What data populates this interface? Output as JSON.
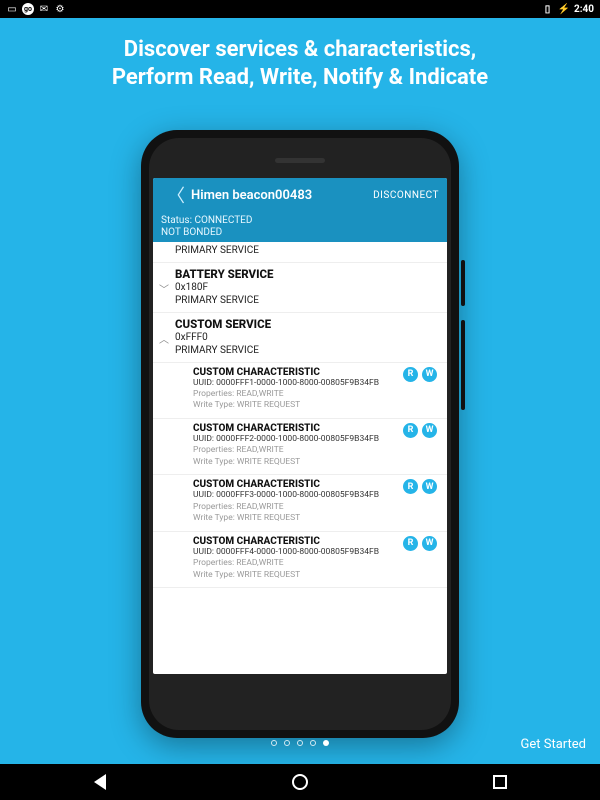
{
  "status_bar": {
    "time": "2:40",
    "battery_icon": "⚡"
  },
  "headline_1": "Discover services & characteristics,",
  "headline_2": "Perform Read, Write, Notify & Indicate",
  "get_started": "Get Started",
  "dots": {
    "count": 5,
    "active_index": 4
  },
  "app": {
    "title": "Himen beacon00483",
    "disconnect": "DISCONNECT",
    "status_label": "Status: CONNECTED",
    "bond_label": "NOT BONDED",
    "services": [
      {
        "name": "",
        "uuid_line": "PRIMARY SERVICE",
        "collapsed": true,
        "show_chevron": false,
        "header_only": true
      },
      {
        "name": "BATTERY SERVICE",
        "uuid": "0x180F",
        "type": "PRIMARY SERVICE",
        "collapsed": true,
        "chevron": "﹀"
      },
      {
        "name": "CUSTOM SERVICE",
        "uuid": "0xFFF0",
        "type": "PRIMARY SERVICE",
        "collapsed": false,
        "chevron": "︿",
        "characteristics": [
          {
            "name": "CUSTOM CHARACTERISTIC",
            "uuid": "UUID: 0000FFF1-0000-1000-8000-00805F9B34FB",
            "props": "Properties: READ,WRITE",
            "wt": "Write Type: WRITE REQUEST",
            "badges": [
              "R",
              "W"
            ]
          },
          {
            "name": "CUSTOM CHARACTERISTIC",
            "uuid": "UUID: 0000FFF2-0000-1000-8000-00805F9B34FB",
            "props": "Properties: READ,WRITE",
            "wt": "Write Type: WRITE REQUEST",
            "badges": [
              "R",
              "W"
            ]
          },
          {
            "name": "CUSTOM CHARACTERISTIC",
            "uuid": "UUID: 0000FFF3-0000-1000-8000-00805F9B34FB",
            "props": "Properties: READ,WRITE",
            "wt": "Write Type: WRITE REQUEST",
            "badges": [
              "R",
              "W"
            ]
          },
          {
            "name": "CUSTOM CHARACTERISTIC",
            "uuid": "UUID: 0000FFF4-0000-1000-8000-00805F9B34FB",
            "props": "Properties: READ,WRITE",
            "wt": "Write Type: WRITE REQUEST",
            "badges": [
              "R",
              "W"
            ]
          }
        ]
      }
    ]
  }
}
